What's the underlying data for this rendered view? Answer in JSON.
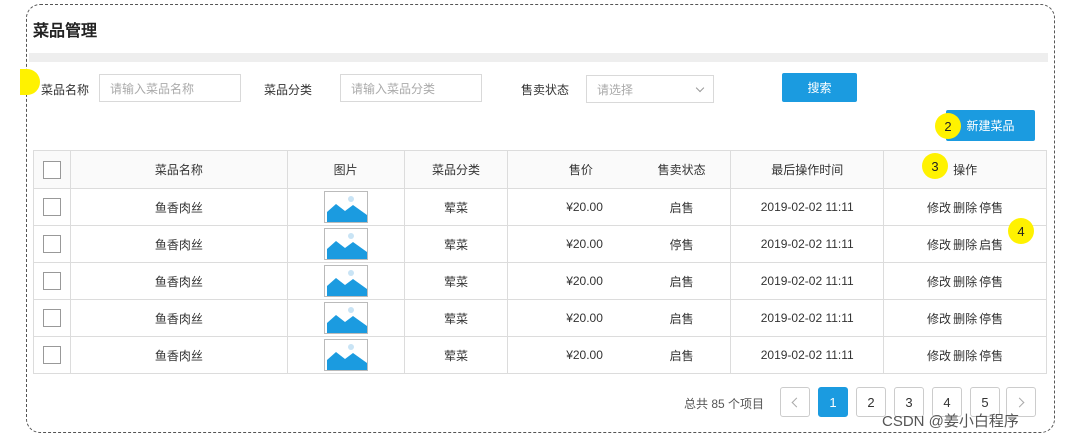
{
  "page": {
    "title": "菜品管理"
  },
  "filters": {
    "name_label": "菜品名称",
    "name_placeholder": "请输入菜品名称",
    "category_label": "菜品分类",
    "category_placeholder": "请输入菜品分类",
    "status_label": "售卖状态",
    "status_placeholder": "请选择",
    "search_label": "搜索"
  },
  "actions": {
    "new_dish_label": "新建菜品"
  },
  "markers": [
    "2",
    "3",
    "4"
  ],
  "table": {
    "headers": [
      "菜品名称",
      "图片",
      "菜品分类",
      "售价",
      "售卖状态",
      "最后操作时间",
      "操作"
    ],
    "rows": [
      {
        "name": "鱼香肉丝",
        "category": "荤菜",
        "price": "¥20.00",
        "status": "启售",
        "time": "2019-02-02 11:11",
        "ops": [
          "修改",
          "删除",
          "停售"
        ]
      },
      {
        "name": "鱼香肉丝",
        "category": "荤菜",
        "price": "¥20.00",
        "status": "停售",
        "time": "2019-02-02 11:11",
        "ops": [
          "修改",
          "删除",
          "启售"
        ]
      },
      {
        "name": "鱼香肉丝",
        "category": "荤菜",
        "price": "¥20.00",
        "status": "启售",
        "time": "2019-02-02 11:11",
        "ops": [
          "修改",
          "删除",
          "停售"
        ]
      },
      {
        "name": "鱼香肉丝",
        "category": "荤菜",
        "price": "¥20.00",
        "status": "启售",
        "time": "2019-02-02 11:11",
        "ops": [
          "修改",
          "删除",
          "停售"
        ]
      },
      {
        "name": "鱼香肉丝",
        "category": "荤菜",
        "price": "¥20.00",
        "status": "启售",
        "time": "2019-02-02 11:11",
        "ops": [
          "修改",
          "删除",
          "停售"
        ]
      }
    ]
  },
  "pagination": {
    "total_text": "总共 85 个项目",
    "pages": [
      "1",
      "2",
      "3",
      "4",
      "5"
    ],
    "current": "1"
  },
  "watermark": "CSDN @姜小白程序",
  "colors": {
    "primary": "#1b9be0",
    "marker": "#fff200"
  }
}
